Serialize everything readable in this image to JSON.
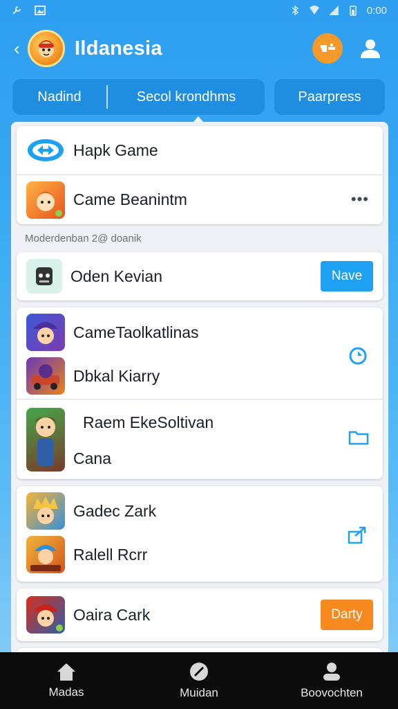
{
  "status_bar": {
    "time": "0:00",
    "left_icons": [
      "wrench-icon",
      "image-icon"
    ],
    "right_icons": [
      "bluetooth-icon",
      "wifi-icon",
      "signal-icon",
      "battery-icon"
    ]
  },
  "header": {
    "title": "Ildanesia",
    "back_icon": "back-arrow-icon",
    "action_icons": [
      "game-controller-icon",
      "user-icon"
    ]
  },
  "tabs": [
    {
      "label": "Nadind"
    },
    {
      "label": "Secol krondhms"
    },
    {
      "label": "Paarpress"
    }
  ],
  "cards": {
    "top": [
      {
        "label": "Hapk Game",
        "icon": "link-logo-icon"
      },
      {
        "label": "Came Beanintm",
        "icon": "game-avatar-icon",
        "action": "more-dots-icon"
      }
    ],
    "section_label": "Moderdenban 2@ doanik",
    "featured": {
      "label": "Oden Kevian",
      "button": "Nave",
      "icon": "robot-icon"
    },
    "group_a": [
      {
        "label": "CameTaolkatlinas"
      },
      {
        "label": "Dbkal Kiarry"
      }
    ],
    "group_b": [
      {
        "label": "Raem EkeSoltivan"
      },
      {
        "label": "Cana"
      }
    ],
    "group_c": [
      {
        "label": "Gadec Zark"
      },
      {
        "label": "Ralell Rcrr"
      }
    ],
    "last": {
      "label": "Oaira Cark",
      "button": "Darty"
    }
  },
  "colors": {
    "accent_blue": "#1ea1f2",
    "accent_orange": "#f7891f",
    "header_bg": "#2d9ef0"
  },
  "bottom_nav": [
    {
      "label": "Madas",
      "icon": "home-icon"
    },
    {
      "label": "Muidan",
      "icon": "compass-icon"
    },
    {
      "label": "Boovochten",
      "icon": "profile-icon"
    }
  ]
}
